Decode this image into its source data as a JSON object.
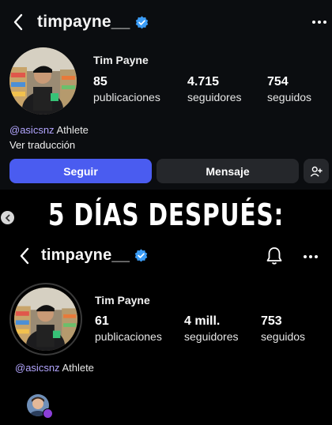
{
  "before": {
    "username": "timpayne__",
    "profile_name": "Tim Payne",
    "stats": [
      {
        "value": "85",
        "label": "publicaciones"
      },
      {
        "value": "4.715",
        "label": "seguidores"
      },
      {
        "value": "754",
        "label": "seguidos"
      }
    ],
    "bio_mention": "@asicsnz",
    "bio_text": " Athlete",
    "translate_link": "Ver traducción",
    "follow_label": "Seguir",
    "message_label": "Mensaje"
  },
  "caption": "5 DÍAS DESPUÉS:",
  "after": {
    "username": "timpayne__",
    "profile_name": "Tim Payne",
    "stats": [
      {
        "value": "61",
        "label": "publicaciones"
      },
      {
        "value": "4 mill.",
        "label": "seguidores"
      },
      {
        "value": "753",
        "label": "seguidos"
      }
    ],
    "bio_mention": "@asicsnz",
    "bio_text": " Athlete"
  },
  "colors": {
    "accent": "#4a5cf0",
    "verified": "#3b9cf6",
    "mention": "#b3a6ff",
    "button_secondary": "#25272b"
  },
  "icons": {
    "back": "chevron-left-icon",
    "verified": "verified-badge-icon",
    "more": "more-horizontal-icon",
    "bell": "bell-icon",
    "add_person": "add-person-icon"
  }
}
